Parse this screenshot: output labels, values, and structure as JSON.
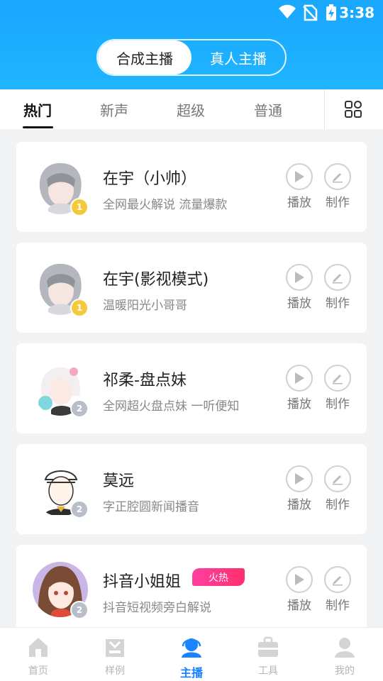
{
  "status": {
    "time": "3:38"
  },
  "segment": {
    "left": "合成主播",
    "right": "真人主播"
  },
  "tabs": [
    "热门",
    "新声",
    "超级",
    "普通"
  ],
  "cards": [
    {
      "name": "在宇（小帅）",
      "desc": "全网最火解说 流量爆款",
      "medal": "gold",
      "medal_text": "1",
      "play": "播放",
      "make": "制作"
    },
    {
      "name": "在宇(影视模式)",
      "desc": "温暖阳光小哥哥",
      "medal": "gold",
      "medal_text": "1",
      "play": "播放",
      "make": "制作"
    },
    {
      "name": "祁柔-盘点妹",
      "desc": "全网超火盘点妹 一听便知",
      "medal": "silver",
      "medal_text": "2",
      "play": "播放",
      "make": "制作"
    },
    {
      "name": "莫远",
      "desc": "字正腔圆新闻播音",
      "medal": "silver",
      "medal_text": "2",
      "play": "播放",
      "make": "制作"
    },
    {
      "name": "抖音小姐姐",
      "desc": "抖音短视频旁白解说",
      "badge": "火热",
      "medal": "silver",
      "medal_text": "2",
      "play": "播放",
      "make": "制作"
    }
  ],
  "bottom_nav": [
    "首页",
    "样例",
    "主播",
    "工具",
    "我的"
  ],
  "colors": {
    "accent": "#1a83ff",
    "header": "#1aa7ff",
    "hot": "#ff2f6e"
  }
}
